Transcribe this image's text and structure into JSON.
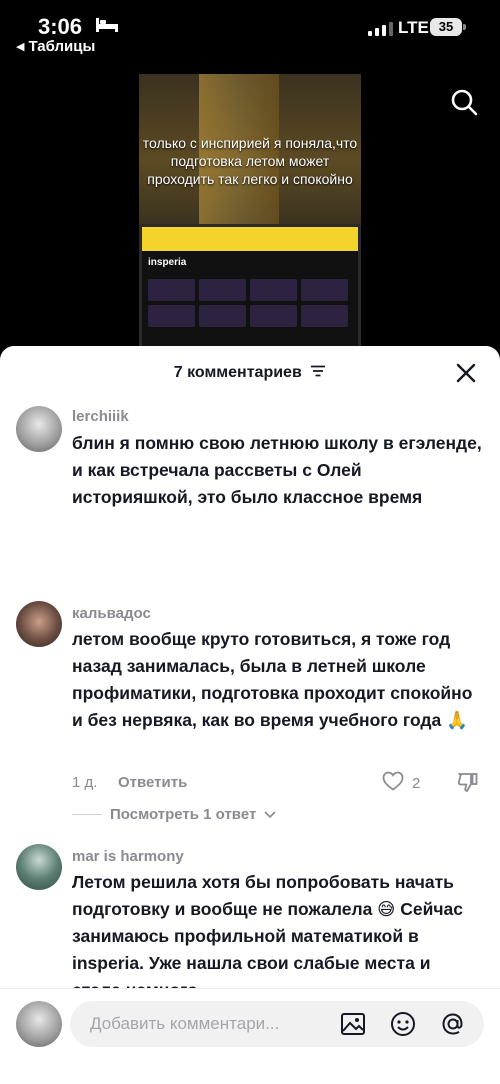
{
  "status_bar": {
    "time": "3:06",
    "back_app": "Таблицы",
    "network": "LTE",
    "battery": "35"
  },
  "video": {
    "caption": "только с инспирией я поняла,что подготовка летом может проходить так легко и спокойно",
    "laptop_logo": "insperia"
  },
  "comments_panel": {
    "title": "7 комментариев",
    "comments": [
      {
        "username": "lerchiiik",
        "text": "блин я помню свою летнюю школу в егэленде, и как встречала рассветы с Олей историяшкой, это было классное время"
      },
      {
        "username": "кальвадос",
        "text": "летом вообще круто готовиться, я тоже год назад занималась, была в летней школе профиматики, подготовка проходит спокойно и без нервяка, как во время учебного года 🙏",
        "age": "1 д.",
        "reply_label": "Ответить",
        "likes": "2",
        "view_replies": "Посмотреть 1 ответ"
      },
      {
        "username": "mar is harmony",
        "text": "Летом решила хотя бы попробовать начать подготовку и вообще не пожалела 😅 Сейчас занимаюсь профильной математикой в insperia. Уже нашла свои слабые места и стала немного"
      }
    ]
  },
  "composer": {
    "placeholder": "Добавить комментари..."
  }
}
